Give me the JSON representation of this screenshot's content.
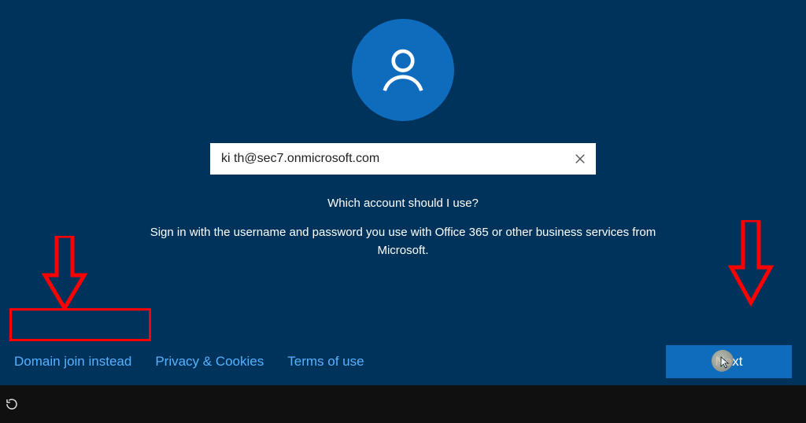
{
  "avatar_icon": "user",
  "email_input": {
    "value": "ki th@sec7.onmicrosoft.com",
    "placeholder": ""
  },
  "prompt_heading": "Which account should I use?",
  "prompt_subtext": "Sign in with the username and password you use with Office 365 or other business services from Microsoft.",
  "links": {
    "domain_join": "Domain join instead",
    "privacy": "Privacy & Cookies",
    "terms": "Terms of use"
  },
  "next_button_label": "Next",
  "colors": {
    "background": "#00335b",
    "accent": "#0f6cbd",
    "link": "#55b1ff",
    "annotation": "#ff0000"
  }
}
